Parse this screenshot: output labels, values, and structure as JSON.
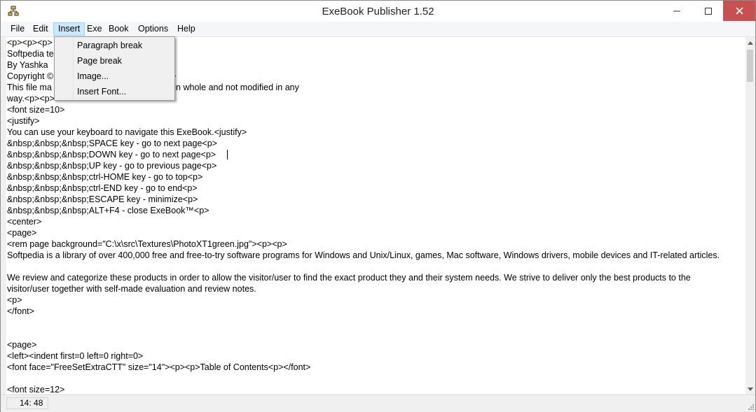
{
  "window": {
    "title": "ExeBook Publisher 1.52"
  },
  "menubar": {
    "items": [
      {
        "label": "File"
      },
      {
        "label": "Edit"
      },
      {
        "label": "Insert",
        "active": true
      },
      {
        "label": "Exe"
      },
      {
        "label": "Book"
      },
      {
        "label": "Options"
      },
      {
        "label": "Help"
      }
    ]
  },
  "insert_menu": {
    "items": [
      {
        "label": "Paragraph break"
      },
      {
        "label": "Page break"
      },
      {
        "label": "Image..."
      },
      {
        "label": "Insert Font..."
      }
    ]
  },
  "editor": {
    "lines": [
      "<p><p><p>",
      "Softpedia te",
      "By Yashka",
      "Copyright ©                                   d.<p><p>",
      "This file ma                                 t is copied in whole and not modified in any",
      "way.<p><p>",
      "<font size=10>",
      "<justify>",
      "You can use your keyboard to navigate this ExeBook.<justify>",
      "&nbsp;&nbsp;&nbsp;SPACE key - go to next page<p>",
      "&nbsp;&nbsp;&nbsp;DOWN key - go to next page<p>",
      "&nbsp;&nbsp;&nbsp;UP key - go to previous page<p>",
      "&nbsp;&nbsp;&nbsp;ctrl-HOME key - go to top<p>",
      "&nbsp;&nbsp;&nbsp;ctrl-END key - go to end<p>",
      "&nbsp;&nbsp;&nbsp;ESCAPE key - minimize<p>",
      "&nbsp;&nbsp;&nbsp;ALT+F4 - close ExeBook™<p>",
      "<center>",
      "<page>",
      "<rem page background=\"C:\\x\\src\\Textures\\PhotoXT1green.jpg\"><p><p>",
      "Softpedia is a library of over 400,000 free and free-to-try software programs for Windows and Unix/Linux, games, Mac software, Windows drivers, mobile devices and IT-related articles.",
      "",
      "We review and categorize these products in order to allow the visitor/user to find the exact product they and their system needs. We strive to deliver only the best products to the",
      "visitor/user together with self-made evaluation and review notes.",
      "<p>",
      "</font>",
      "",
      "",
      "<page>",
      "<left><indent first=0 left=0 right=0>",
      "<font face=\"FreeSetExtraCTT\" size=\"14\"><p><p>Table of Contents<p></font>",
      "",
      "<font size=12>"
    ]
  },
  "statusbar": {
    "cursor_position": "14: 48"
  },
  "icons": {
    "app": "exebook-app-icon",
    "minimize": "minimize-icon",
    "maximize": "maximize-icon",
    "close": "close-icon",
    "scroll_up": "scroll-up-arrow-icon",
    "scroll_down": "scroll-down-arrow-icon",
    "size_grip": "size-grip-icon"
  }
}
